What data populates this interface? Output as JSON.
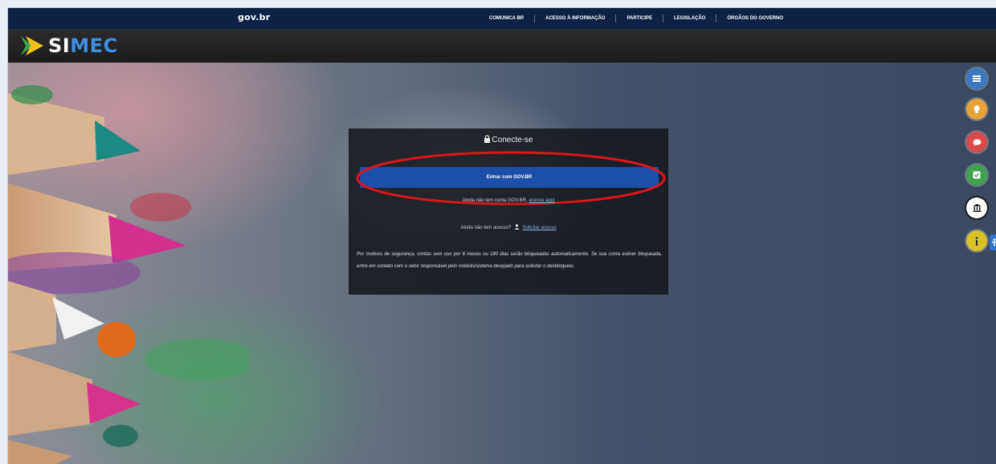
{
  "gov_bar": {
    "logo": "gov.br",
    "links": [
      "COMUNICA BR",
      "ACESSO À INFORMAÇÃO",
      "PARTICIPE",
      "LEGISLAÇÃO",
      "ÓRGÃOS DO GOVERNO"
    ]
  },
  "header": {
    "logo_text_a": "SI",
    "logo_text_b": "MEC"
  },
  "login_card": {
    "title": "Conecte-se",
    "govbr_button": "Entrar com GOV.BR",
    "no_account_text": "Ainda não tem conta GOV.BR,",
    "no_account_link": "acesse aqui",
    "no_access_text": "Ainda não tem acesso?",
    "request_access_link": "Solicitar acesso",
    "notice": "Por motivos de segurança, contas sem uso por 6 meses ou 180 dias serão bloqueadas automaticamente. Se sua conta estiver bloqueada, entre em contato com o setor responsável pelo módulo/sistema desejado para solicitar o desbloqueio."
  },
  "side_buttons": [
    {
      "icon": "list-icon",
      "color": "#3b78c4"
    },
    {
      "icon": "lightbulb-icon",
      "color": "#e8a23a"
    },
    {
      "icon": "chat-icon",
      "color": "#d94a4a"
    },
    {
      "icon": "checkbox-icon",
      "color": "#3fa34d"
    },
    {
      "icon": "institution-icon",
      "color": "#ffffff"
    },
    {
      "icon": "info-icon",
      "color": "#d8c227"
    }
  ],
  "colors": {
    "gov_bar": "#0d2147",
    "govbr_button": "#1b4fa8",
    "highlight_ellipse": "#e0141b"
  }
}
